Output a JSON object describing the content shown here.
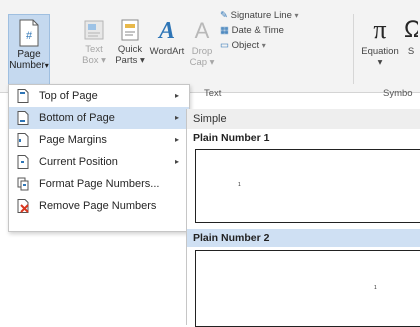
{
  "ribbon": {
    "page_number": {
      "line1": "Page",
      "line2": "Number",
      "arrow": "▾",
      "glyph": "#"
    },
    "text_box": {
      "line1": "Text",
      "line2": "Box ▾"
    },
    "quick_parts": {
      "line1": "Quick",
      "line2": "Parts ▾"
    },
    "wordart": {
      "line1": "WordArt",
      "glyph": "A"
    },
    "drop_cap": {
      "line1": "Drop",
      "line2": "Cap ▾",
      "glyph": "A"
    },
    "signature_line": "Signature Line",
    "date_time": "Date & Time",
    "object": "Object",
    "equation": {
      "line1": "Equation",
      "line2": "▾",
      "glyph": "π"
    },
    "symbol": {
      "line1": "S",
      "glyph": "Ω"
    },
    "group_text": "Text",
    "group_symbols": "Symbo"
  },
  "menu": {
    "items": [
      {
        "label": "Top of Page",
        "submenu": "▸"
      },
      {
        "label": "Bottom of Page",
        "submenu": "▸"
      },
      {
        "label": "Page Margins",
        "submenu": "▸"
      },
      {
        "label": "Current Position",
        "submenu": "▸"
      },
      {
        "label": "Format Page Numbers..."
      },
      {
        "label": "Remove Page Numbers"
      }
    ]
  },
  "gallery": {
    "header": "Simple",
    "items": [
      {
        "title": "Plain Number 1",
        "number": "1"
      },
      {
        "title": "Plain Number 2",
        "number": "1"
      }
    ]
  },
  "colors": {
    "highlight": "#cfe0f3",
    "accent": "#2e75b6",
    "remove_red": "#d9361e"
  }
}
